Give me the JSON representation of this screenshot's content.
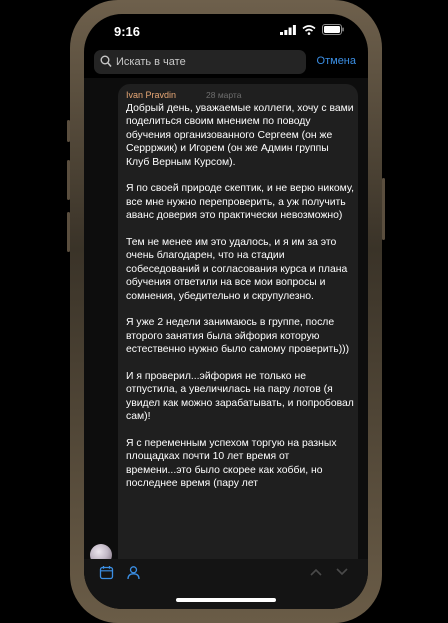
{
  "status_bar": {
    "time": "9:16"
  },
  "search": {
    "placeholder": "Искать в чате",
    "cancel_label": "Отмена"
  },
  "message": {
    "sender": "Ivan Pravdin",
    "date": "28 марта",
    "paragraphs": [
      "Добрый день, уважаемые коллеги, хочу с вами поделиться своим мнением по поводу обучения организованного Сергеем (он же Серрржик) и Игорем (он же Админ группы Клуб Верным Курсом).",
      "Я по своей природе скептик, и не верю никому, все мне нужно перепроверить, а уж получить аванс доверия это практически невозможно)",
      "Тем не менее им это удалось, и я им за это очень благодарен, что на стадии собеседований и согласования курса и плана обучения ответили на все мои вопросы и сомнения, убедительно и скрупулезно.",
      "Я уже 2 недели занимаюсь в группе, после второго занятия была эйфория которую естественно нужно было самому проверить)))",
      "И я проверил...эйфория не только не отпустила, а увеличилась на пару лотов (я увидел как можно зарабатывать, и попробовал сам)!",
      "Я с переменным успехом торгую на разных площадках почти 10 лет время от времени...это было скорее как хобби, но последнее время (пару лет"
    ]
  },
  "icons": {
    "signal": "signal-bars-icon",
    "wifi": "wifi-icon",
    "battery": "battery-icon",
    "search": "search-icon",
    "calendar": "calendar-icon",
    "person": "person-icon",
    "up": "chevron-up-icon",
    "down": "chevron-down-icon"
  },
  "colors": {
    "accent": "#3b8fe5",
    "sender": "#e8a876",
    "bubble": "#1f1f1f",
    "frame": "#6e604c"
  }
}
